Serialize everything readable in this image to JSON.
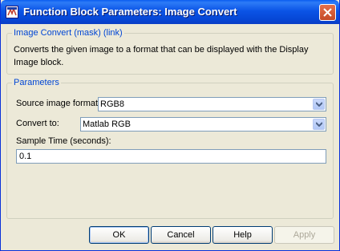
{
  "window": {
    "title": "Function Block Parameters: Image Convert"
  },
  "mask_group": {
    "legend": "Image Convert (mask) (link)",
    "description": "Converts the given image to a format that can be displayed with the Display Image block."
  },
  "parameters_group": {
    "legend": "Parameters",
    "source_format": {
      "label": "Source image format:",
      "value": "RGB8"
    },
    "convert_to": {
      "label": "Convert to:",
      "value": "Matlab RGB"
    },
    "sample_time": {
      "label": "Sample Time (seconds):",
      "value": "0.1"
    }
  },
  "buttons": {
    "ok": "OK",
    "cancel": "Cancel",
    "help": "Help",
    "apply": "Apply"
  },
  "colors": {
    "titlebar": "#0A5DF0",
    "group_legend": "#0046D5",
    "dialog_bg": "#ECE9D8",
    "close_button": "#E0603B"
  },
  "icons": [
    "simulink-icon",
    "close-icon",
    "dropdown-arrow-icon"
  ]
}
